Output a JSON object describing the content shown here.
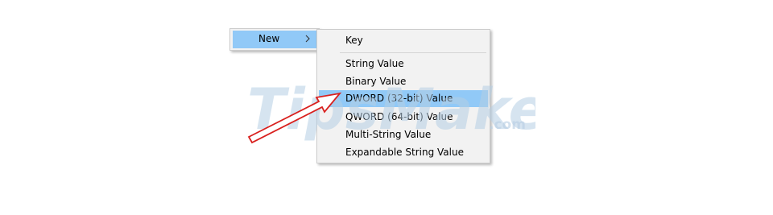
{
  "parent_menu": {
    "new_label": "New"
  },
  "submenu": {
    "items": [
      {
        "label": "Key"
      },
      {
        "label": "String Value"
      },
      {
        "label": "Binary Value"
      },
      {
        "label": "DWORD (32-bit) Value"
      },
      {
        "label": "QWORD (64-bit) Value"
      },
      {
        "label": "Multi-String Value"
      },
      {
        "label": "Expandable String Value"
      }
    ],
    "highlighted_index": 3
  },
  "watermark": {
    "text_main": "TipsMake",
    "text_suffix": ".com"
  },
  "colors": {
    "menu_bg": "#f2f2f2",
    "highlight": "#91c9f7",
    "arrow": "#d9201e",
    "watermark": "#b5cde3"
  }
}
